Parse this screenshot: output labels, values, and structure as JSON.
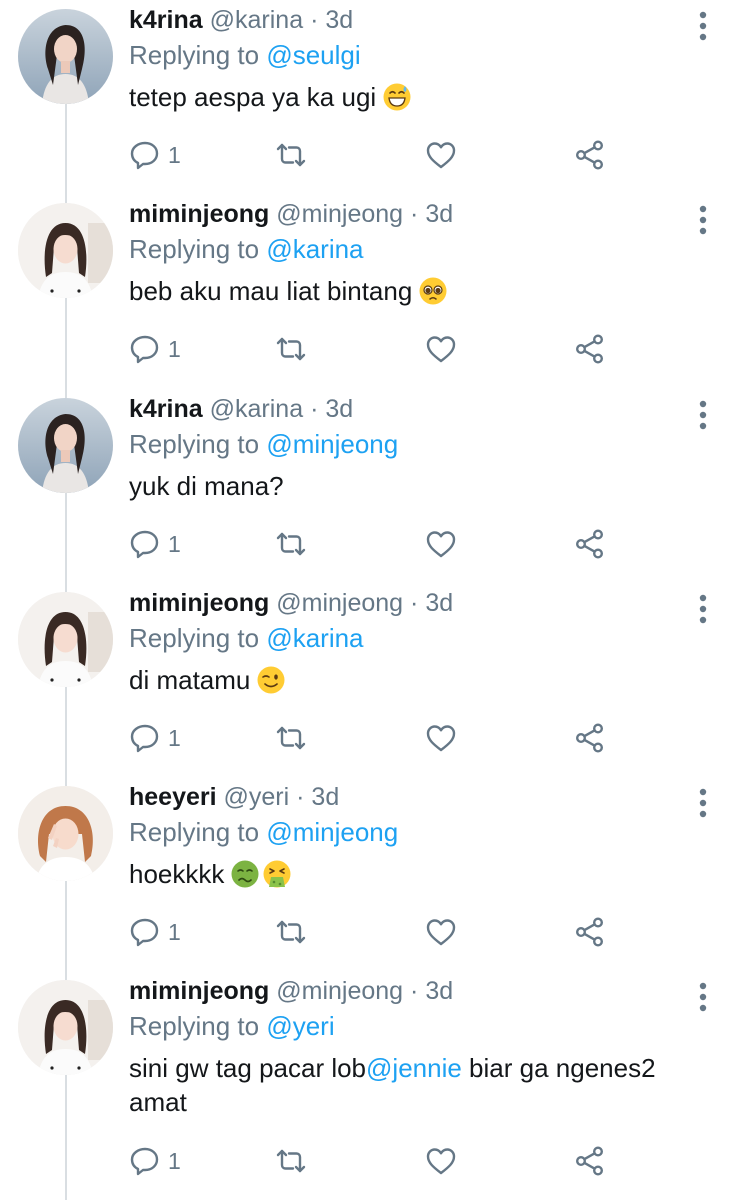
{
  "colors": {
    "mention": "#1da1f2",
    "secondary_text": "#657786",
    "primary_text": "#14171a",
    "thread_line": "#d9dee2"
  },
  "tweets": [
    {
      "name": "k4rina",
      "handle": "@karina",
      "dot": "·",
      "time": "3d",
      "reply_prefix": "Replying to ",
      "reply_to": "@seulgi",
      "text_before": "tetep aespa ya ka ugi",
      "text_mention": "",
      "text_after": "",
      "emoji": [
        "grinning-sweat-emoji"
      ],
      "avatar_icon": "karina-avatar",
      "reply_count": "1"
    },
    {
      "name": "miminjeong",
      "handle": "@minjeong",
      "dot": "·",
      "time": "3d",
      "reply_prefix": "Replying to ",
      "reply_to": "@karina",
      "text_before": "beb aku mau liat bintang",
      "text_mention": "",
      "text_after": "",
      "emoji": [
        "pleading-face-emoji"
      ],
      "avatar_icon": "minjeong-avatar",
      "reply_count": "1"
    },
    {
      "name": "k4rina",
      "handle": "@karina",
      "dot": "·",
      "time": "3d",
      "reply_prefix": "Replying to ",
      "reply_to": "@minjeong",
      "text_before": "yuk di mana?",
      "text_mention": "",
      "text_after": "",
      "emoji": [],
      "avatar_icon": "karina-avatar",
      "reply_count": "1"
    },
    {
      "name": "miminjeong",
      "handle": "@minjeong",
      "dot": "·",
      "time": "3d",
      "reply_prefix": "Replying to ",
      "reply_to": "@karina",
      "text_before": "di matamu",
      "text_mention": "",
      "text_after": "",
      "emoji": [
        "winking-face-emoji"
      ],
      "avatar_icon": "minjeong-avatar",
      "reply_count": "1"
    },
    {
      "name": "heeyeri",
      "handle": "@yeri",
      "dot": "·",
      "time": "3d",
      "reply_prefix": "Replying to ",
      "reply_to": "@minjeong",
      "text_before": "hoekkkk",
      "text_mention": "",
      "text_after": "",
      "emoji": [
        "nauseated-face-emoji",
        "vomiting-face-emoji"
      ],
      "avatar_icon": "yeri-avatar",
      "reply_count": "1"
    },
    {
      "name": "miminjeong",
      "handle": "@minjeong",
      "dot": "·",
      "time": "3d",
      "reply_prefix": "Replying to ",
      "reply_to": "@yeri",
      "text_before": "sini gw tag pacar lob",
      "text_mention": "@jennie",
      "text_after": " biar ga ngenes2 amat",
      "emoji": [],
      "avatar_icon": "minjeong-avatar",
      "reply_count": "1"
    }
  ]
}
